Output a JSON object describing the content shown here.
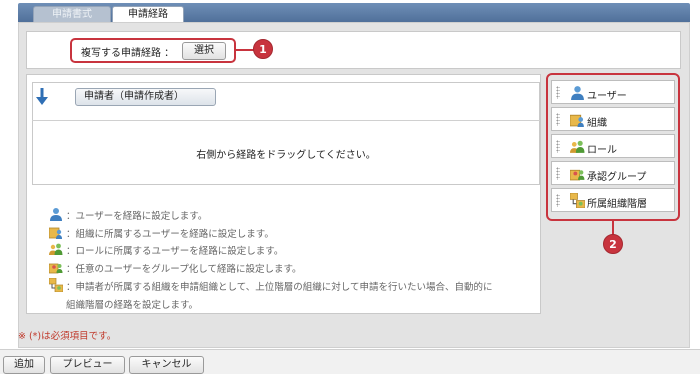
{
  "tabs": [
    {
      "label": "申請書式",
      "active": false
    },
    {
      "label": "申請経路",
      "active": true
    }
  ],
  "copy_route": {
    "label": "複写する申請経路 ：",
    "select_button": "選択",
    "callout_number": "1"
  },
  "route": {
    "applicant_button": "申請者（申請作成者）",
    "drag_message": "右側から経路をドラッグしてください。"
  },
  "legend": [
    {
      "icon": "user-icon",
      "text": "：ユーザーを経路に設定します。"
    },
    {
      "icon": "organization-icon",
      "text": "：組織に所属するユーザーを経路に設定します。"
    },
    {
      "icon": "role-icon",
      "text": "：ロールに所属するユーザーを経路に設定します。"
    },
    {
      "icon": "approval-group-icon",
      "text": "：任意のユーザーをグループ化して経路に設定します。"
    },
    {
      "icon": "org-hierarchy-icon",
      "text": "：申請者が所属する組織を申請組織として、上位階層の組織に対して申請を行いたい場合、自動的に"
    },
    {
      "icon": "",
      "text": "組織階層の経路を設定します。"
    }
  ],
  "palette": {
    "items": [
      {
        "icon": "user-icon",
        "label": "ユーザー"
      },
      {
        "icon": "organization-icon",
        "label": "組織"
      },
      {
        "icon": "role-icon",
        "label": "ロール"
      },
      {
        "icon": "approval-group-icon",
        "label": "承認グループ"
      },
      {
        "icon": "org-hierarchy-icon",
        "label": "所属組織階層"
      }
    ],
    "callout_number": "2"
  },
  "required_note": "※ (*)は必須項目です。",
  "footer": {
    "add": "追加",
    "preview": "プレビュー",
    "cancel": "キャンセル"
  },
  "colors": {
    "callout": "#c8343e",
    "tab_bar": "#5b7ba5",
    "required_note": "#c0392b"
  }
}
